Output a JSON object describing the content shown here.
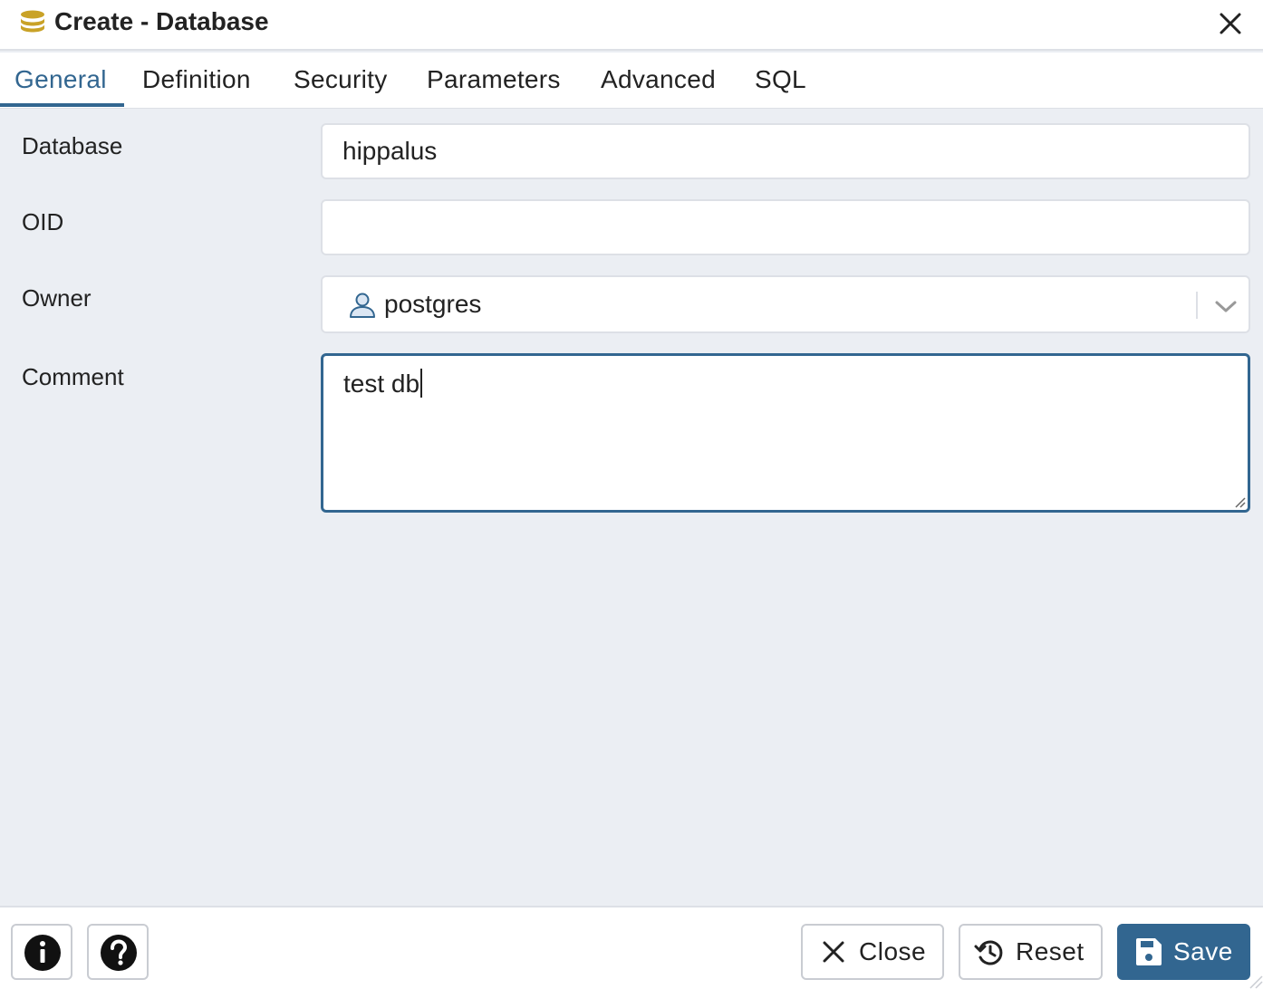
{
  "dialog": {
    "title": "Create - Database",
    "icon": "database-icon",
    "accent_color": "#326690"
  },
  "tabs": [
    {
      "label": "General",
      "active": true
    },
    {
      "label": "Definition",
      "active": false
    },
    {
      "label": "Security",
      "active": false
    },
    {
      "label": "Parameters",
      "active": false
    },
    {
      "label": "Advanced",
      "active": false
    },
    {
      "label": "SQL",
      "active": false
    }
  ],
  "form": {
    "database": {
      "label": "Database",
      "value": "hippalus"
    },
    "oid": {
      "label": "OID",
      "value": ""
    },
    "owner": {
      "label": "Owner",
      "value": "postgres",
      "icon": "user-icon"
    },
    "comment": {
      "label": "Comment",
      "value": "test db"
    }
  },
  "footer": {
    "info_icon": "info-icon",
    "help_icon": "help-icon",
    "close_label": "Close",
    "reset_label": "Reset",
    "save_label": "Save"
  }
}
